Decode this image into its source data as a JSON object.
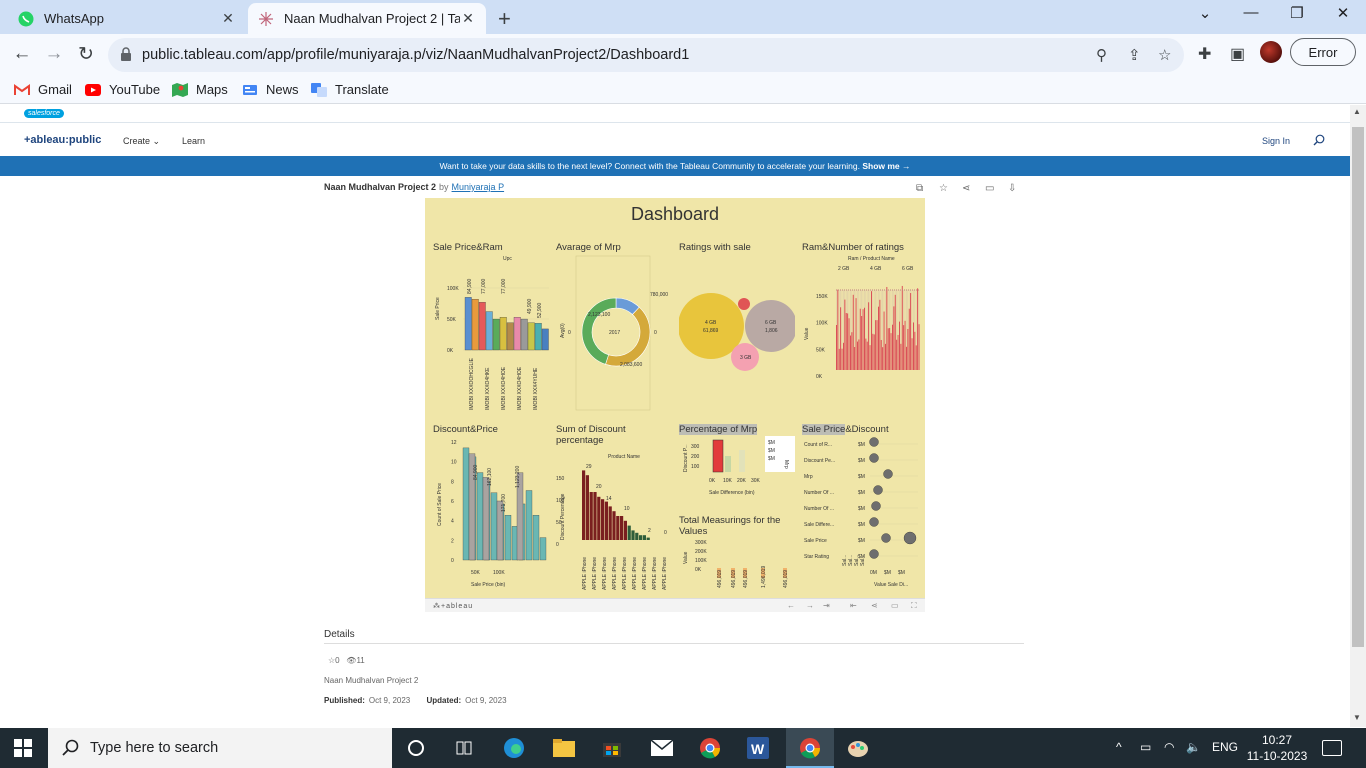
{
  "browser": {
    "tabs": [
      {
        "title": "WhatsApp"
      },
      {
        "title": "Naan Mudhalvan Project 2 | Tab"
      }
    ],
    "url": "public.tableau.com/app/profile/muniyaraja.p/viz/NaanMudhalvanProject2/Dashboard1",
    "profile_button": "Error",
    "bookmarks": [
      "Gmail",
      "YouTube",
      "Maps",
      "News",
      "Translate"
    ]
  },
  "site": {
    "salesforce_label": "salesforce",
    "logo": "+ableau:public",
    "nav": {
      "create": "Create",
      "learn": "Learn",
      "signin": "Sign In"
    },
    "banner_text": "Want to take your data skills to the next level? Connect with the Tableau Community to accelerate your learning.",
    "banner_link": "Show me →"
  },
  "viz": {
    "name": "Naan Mudhalvan Project 2",
    "by": "by",
    "author": "Muniyaraja P"
  },
  "dashboard": {
    "title": "Dashboard",
    "sheets": {
      "sale_price_ram": "Sale Price&Ram",
      "avg_mrp": "Avarage of Mrp",
      "ratings_with_sale": "Ratings with sale",
      "ram_num_ratings": "Ram&Number of ratings",
      "discount_price": "Discount&Price",
      "sum_discount_pct": "Sum of Discount percentage",
      "pct_mrp": "Percentage of Mrp",
      "sale_price_discount_a": "Sale Price",
      "sale_price_discount_b": "&Discount",
      "total_measurings": "Total Measurings for the Values"
    },
    "labels": {
      "upc": "Upc",
      "sale_price_axis": "Sale Price",
      "avg_axis": "Avg(0)",
      "ram_product_name": "Ram / Product Name",
      "ram_cols": [
        "2 GB",
        "4 GB",
        "6 GB"
      ],
      "value_axis": "Value",
      "count_sale_price": "Count of Sale Price",
      "discount_percentage": "Discount Percentage",
      "product_name": "Product Name",
      "sale_price_bin": "Sale Price (bin)",
      "sale_difference_bin": "Sale Difference (bin)",
      "discount_p": "Discount P...",
      "mrp": "Mrp",
      "measure_rows": [
        "Count of R...",
        "Discount Pe...",
        "Mrp",
        "Number Of ...",
        "Number Of ...",
        "Sale Differe...",
        "Sale Price",
        "Star Rating"
      ],
      "value_sal": "Value  Sale Di...",
      "donut_center": "2017",
      "bubble_4gb": "4 GB",
      "bubble_4gb_val": "61,869",
      "bubble_6gb": "6 GB",
      "bubble_6gb_val": "1,806",
      "bubble_3gb": "3 GB"
    }
  },
  "chart_data": [
    {
      "type": "bar",
      "title": "Sale Price&Ram",
      "ylabel": "Sale Price",
      "yticks": [
        "100K",
        "50K",
        "0K"
      ],
      "categories": [
        "IMOBI XXXOOHCGLIE",
        "IMOBI XXXO4HKE",
        "IMOBI XXXO4HOE",
        "IMOBI XXXO4HOE",
        "IMOBI XXX4YUHE",
        "IMOBI XXX4YUHE",
        "VEPHXX7GYY4AF0"
      ],
      "values": [
        84900,
        77000,
        77000,
        49900,
        49900,
        52900,
        44000
      ],
      "data_labels": [
        "84,900",
        "77,000",
        "77,000",
        "49,900",
        "52,900"
      ]
    },
    {
      "type": "pie",
      "title": "Avarage of Mrp",
      "ylabel": "Avg(0)",
      "labels": [
        "780,000",
        "2,123,100",
        "2,083,600"
      ],
      "colors": [
        "#6a9bd8",
        "#d4a93a",
        "#5aab5a"
      ]
    },
    {
      "type": "scatter",
      "title": "Ratings with sale",
      "bubbles": [
        {
          "name": "4 GB",
          "value": 61869,
          "color": "#e8c53c"
        },
        {
          "name": "6 GB",
          "value": 1806,
          "color": "#b9a9a4"
        },
        {
          "name": "3 GB",
          "color": "#f4a1b1"
        },
        {
          "name": "",
          "color": "#e05555"
        }
      ]
    },
    {
      "type": "bar",
      "title": "Ram&Number of ratings",
      "ylabel": "Value",
      "yticks": [
        "150K",
        "100K",
        "50K",
        "0K"
      ]
    },
    {
      "type": "bar",
      "title": "Discount&Price",
      "xlabel": "Sale Price (bin)",
      "ylabel": "Count of Sale Price",
      "yticks": [
        "12",
        "10",
        "8",
        "6",
        "4",
        "2",
        "0"
      ],
      "xticks": [
        "50K",
        "100K"
      ],
      "data_labels": [
        "84,900",
        "162,100",
        "171,700",
        "1,123,200"
      ]
    },
    {
      "type": "bar",
      "title": "Sum of Discount percentage",
      "ylabel": "Discount Percentage",
      "yticks": [
        "150",
        "100",
        "50",
        "0"
      ],
      "values": [
        29,
        20,
        14,
        10,
        2,
        0
      ]
    },
    {
      "type": "bar",
      "title": "Percentage of Mrp",
      "xlabel": "Sale Difference (bin)",
      "yticks": [
        "300",
        "200",
        "100"
      ],
      "xticks": [
        "0K",
        "10K",
        "20K",
        "30K"
      ],
      "legend": [
        "$M",
        "$M",
        "$M"
      ]
    },
    {
      "type": "bar",
      "title": "Total Measurings for the Values",
      "ylabel": "Value",
      "yticks": [
        "300K",
        "200K",
        "100K",
        "0K"
      ],
      "data_labels": [
        "496,019",
        "496,019",
        "496,019",
        "1,496,019",
        "496,019"
      ]
    },
    {
      "type": "scatter",
      "title": "Sale Price&Discount",
      "xticks": [
        "0M",
        "$M",
        "$M"
      ]
    }
  ],
  "details": {
    "heading": "Details",
    "favorites": "0",
    "views": "11",
    "name": "Naan Mudhalvan Project 2",
    "published_label": "Published:",
    "published": "Oct 9, 2023",
    "updated_label": "Updated:",
    "updated": "Oct 9, 2023"
  },
  "taskbar": {
    "search_placeholder": "Type here to search",
    "lang": "ENG",
    "time": "10:27",
    "date": "11-10-2023"
  }
}
